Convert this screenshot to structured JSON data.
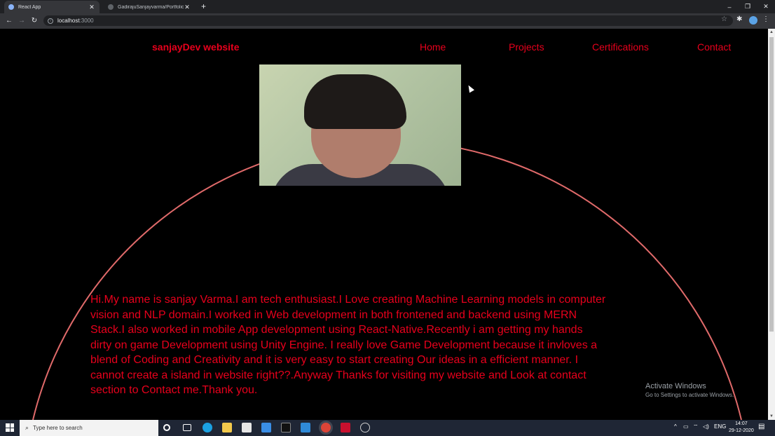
{
  "browser": {
    "tabs": [
      {
        "title": "React App",
        "active": true
      },
      {
        "title": "GadirajuSanjayvarma/PortfolioW",
        "active": false
      }
    ],
    "url_host": "localhost",
    "url_port": ":3000",
    "window_controls": {
      "minimize": "–",
      "restore": "❐",
      "close": "✕"
    }
  },
  "site": {
    "brand": "sanjayDev website",
    "nav": [
      "Home",
      "Projects",
      "Certifications",
      "Contact"
    ],
    "bio_lines": [
      "Hi.My name is sanjay Varma.I am tech enthusiast.I Love creating Machine Learning models in computer",
      "vision and NLP domain.I worked in Web development in both frontened and backend using MERN",
      "Stack.I also worked in mobile App development using React-Native.Recently i am getting my hands",
      "dirty on game Development using Unity Engine. I really love Game Development because it invloves a",
      "blend of Coding and Creativity and it is very easy to start creating Our ideas in a efficient manner. I",
      "cannot create a island in website right??.Anyway Thanks for visiting my website and Look at contact",
      "section to Contact me.Thank you."
    ],
    "accent_color": "#e8001c"
  },
  "watermark": {
    "title": "Activate Windows",
    "subtitle": "Go to Settings to activate Windows."
  },
  "taskbar": {
    "search_placeholder": "Type here to search",
    "lang": "ENG",
    "time": "14:07",
    "date": "29-12-2020"
  }
}
